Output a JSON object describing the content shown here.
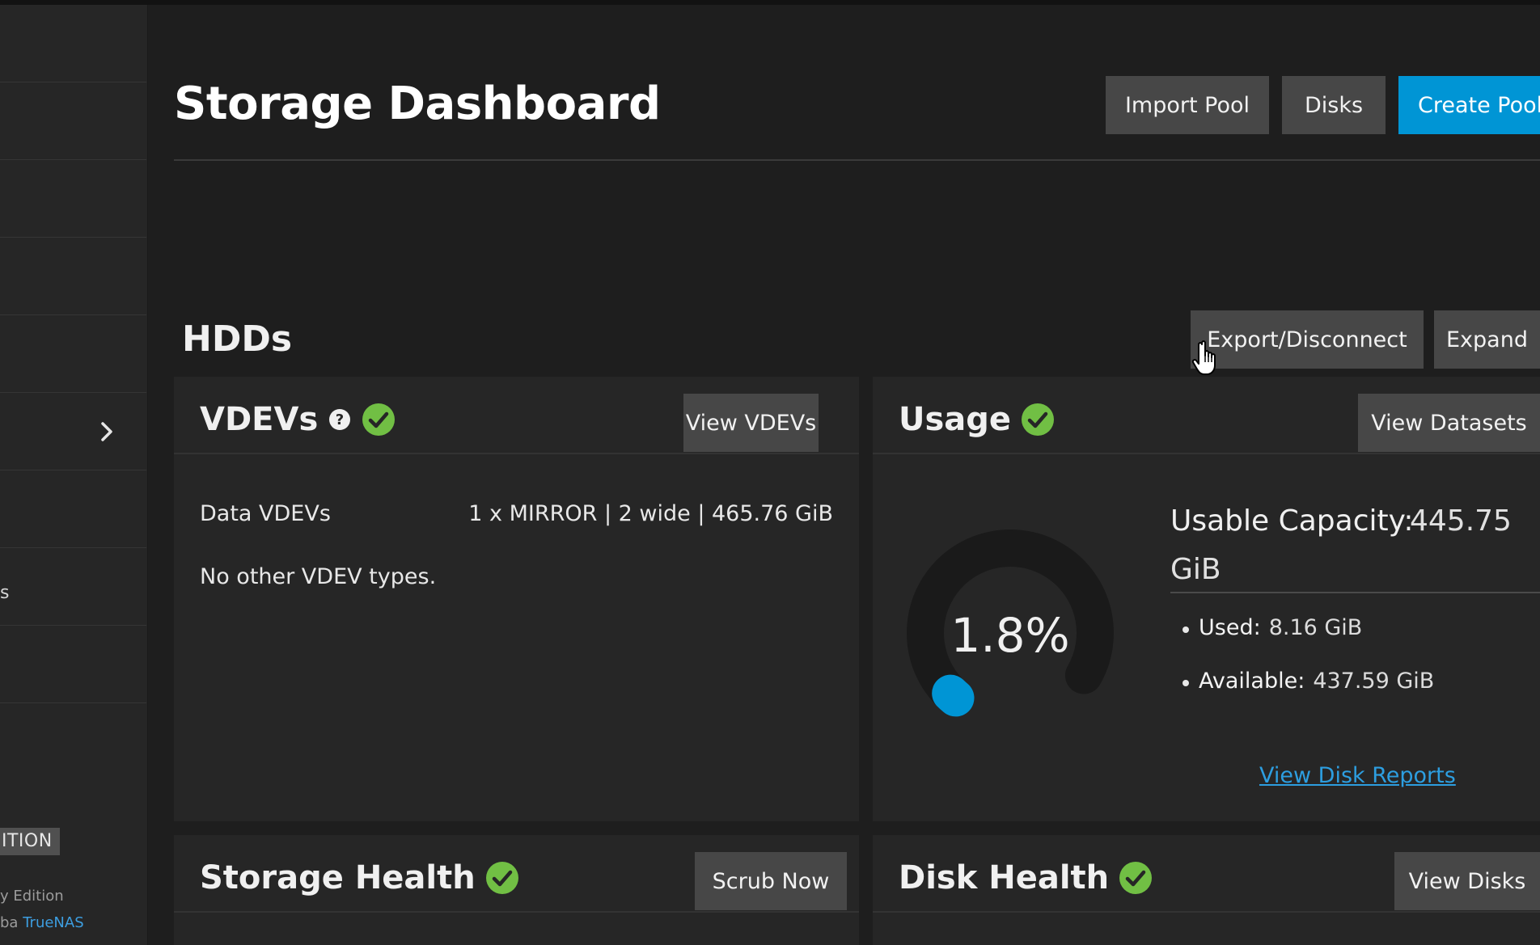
{
  "header": {
    "title": "Storage Dashboard",
    "buttons": {
      "import_pool": "Import Pool",
      "disks": "Disks",
      "create_pool": "Create Pool"
    }
  },
  "sidebar": {
    "partial_label": "s",
    "edition_badge": "ITION",
    "edition_line": "y Edition",
    "credit_prefix": "ba ",
    "credit_link": "TrueNAS"
  },
  "pool": {
    "name": "HDDs",
    "buttons": {
      "export": "Export/Disconnect",
      "expand": "Expand"
    }
  },
  "vdevs_card": {
    "title": "VDEVs",
    "button": "View VDEVs",
    "data_vdevs_label": "Data VDEVs",
    "data_vdevs_value": "1 x MIRROR | 2 wide | 465.76 GiB",
    "other_types": "No other VDEV types."
  },
  "usage_card": {
    "title": "Usage",
    "button": "View Datasets",
    "percent_text": "1.8%",
    "percent_used": 1.8,
    "capacity_label": "Usable Capacity:",
    "capacity_value": "445.75",
    "capacity_unit": "GiB",
    "used_label": "Used:",
    "used_value": "8.16 GiB",
    "available_label": "Available:",
    "available_value": "437.59 GiB",
    "reports_link": "View Disk Reports"
  },
  "storage_health_card": {
    "title": "Storage Health",
    "button": "Scrub Now"
  },
  "disk_health_card": {
    "title": "Disk Health",
    "button": "View Disks"
  },
  "colors": {
    "accent": "#0095d5",
    "ok": "#71bf44",
    "background": "#1e1e1e",
    "card": "#262626"
  }
}
